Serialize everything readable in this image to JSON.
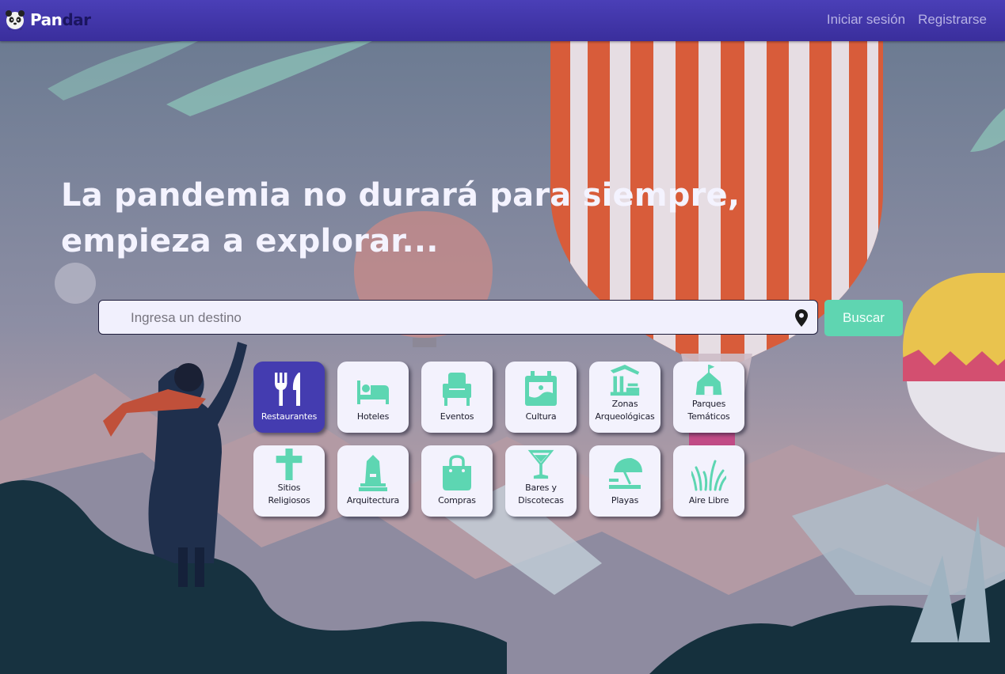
{
  "brand": {
    "part1": "Pan",
    "part2": "dar"
  },
  "nav": {
    "login": "Iniciar sesión",
    "register": "Registrarse"
  },
  "hero": {
    "title": "La pandemia no durará para siempre, empieza a explorar..."
  },
  "search": {
    "placeholder": "Ingresa un destino",
    "button": "Buscar",
    "icon": "map-pin-icon"
  },
  "colors": {
    "nav": "#3f35aa",
    "accent": "#5fd5b1",
    "active_category": "#443cb0",
    "icon_green": "#5dd6b2"
  },
  "categories": [
    {
      "label": "Restaurantes",
      "icon": "fork-knife-icon",
      "active": true
    },
    {
      "label": "Hoteles",
      "icon": "bed-icon"
    },
    {
      "label": "Eventos",
      "icon": "armchair-icon"
    },
    {
      "label": "Cultura",
      "icon": "calendar-palette-icon"
    },
    {
      "label": "Zonas\nArqueológicas",
      "icon": "ruins-icon"
    },
    {
      "label": "Parques\nTemáticos",
      "icon": "tent-icon"
    },
    {
      "label": "Sitios\nReligiosos",
      "icon": "cross-icon"
    },
    {
      "label": "Arquitectura",
      "icon": "monument-icon"
    },
    {
      "label": "Compras",
      "icon": "shopping-bag-icon"
    },
    {
      "label": "Bares y\nDiscotecas",
      "icon": "cocktail-icon"
    },
    {
      "label": "Playas",
      "icon": "beach-umbrella-icon"
    },
    {
      "label": "Aire Libre",
      "icon": "grass-icon"
    }
  ]
}
